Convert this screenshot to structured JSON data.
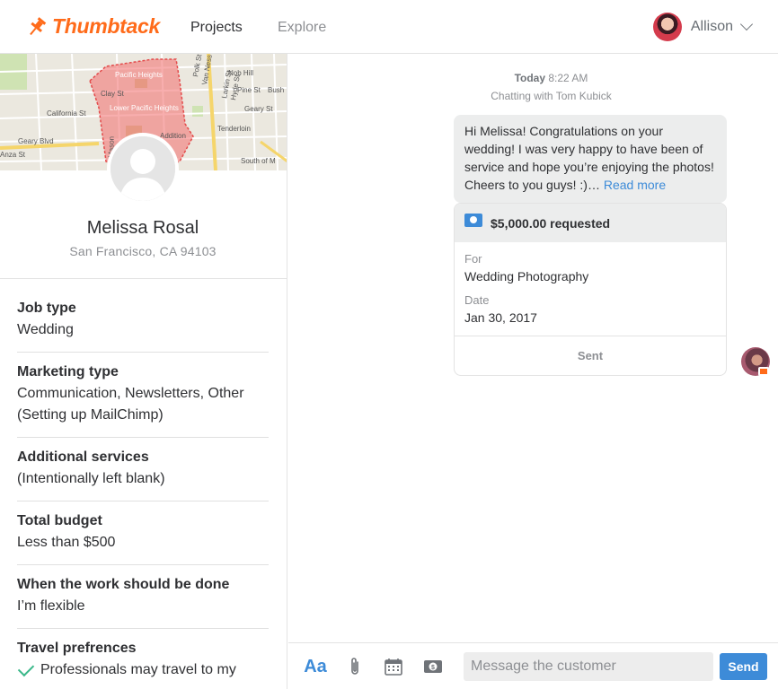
{
  "header": {
    "brand": "Thumbtack",
    "nav": [
      {
        "label": "Projects",
        "active": true
      },
      {
        "label": "Explore",
        "active": false
      }
    ],
    "user_name": "Allison"
  },
  "map": {
    "labels": [
      "Pacific Heights",
      "Clay St",
      "California St",
      "Lower Pacific Heights",
      "Geary Blvd",
      "Anza St",
      "Nob Hill",
      "Pine St",
      "Bush",
      "Geary St",
      "Tenderloin",
      "Addition",
      "South of M",
      "Mason",
      "Larkin St",
      "Hyde St",
      "Polk St",
      "Van Ness"
    ],
    "highlight_color": "#f26b6b"
  },
  "profile": {
    "name": "Melissa Rosal",
    "location": "San Francisco, CA 94103"
  },
  "details": [
    {
      "label": "Job type",
      "value": "Wedding"
    },
    {
      "label": "Marketing type",
      "value": "Communication, Newsletters, Other (Setting up MailChimp)"
    },
    {
      "label": "Additional services",
      "value": "(Intentionally left blank)"
    },
    {
      "label": "Total budget",
      "value": "Less than $500"
    },
    {
      "label": "When the work should be done",
      "value": "I’m flexible"
    },
    {
      "label": "Travel prefrences",
      "value": "Professionals may travel to my"
    }
  ],
  "chat": {
    "day": "Today",
    "time": "8:22 AM",
    "chatting_with": "Chatting with Tom Kubick",
    "message": "Hi Melissa! Congratulations on your wedding! I was very happy to have been of service and hope you’re enjoying the photos! Cheers to you guys! :)…",
    "read_more": "Read more",
    "payment": {
      "amount": "$5,000.00 requested",
      "for_label": "For",
      "for_value": "Wedding Photography",
      "date_label": "Date",
      "date_value": "Jan 30, 2017",
      "status": "Sent"
    }
  },
  "composer": {
    "font_label": "Aa",
    "placeholder": "Message the customer",
    "send_label": "Send",
    "icons": [
      "text-format-icon",
      "paperclip-icon",
      "calendar-icon",
      "payment-icon"
    ]
  },
  "colors": {
    "brand": "#ff6b1a",
    "accent": "#3d8bd8",
    "check": "#3bb88a"
  }
}
